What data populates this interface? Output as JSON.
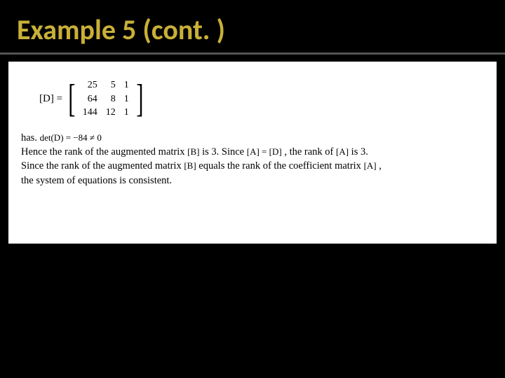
{
  "title": "Example 5 (cont. )",
  "matrix": {
    "lhs": "[D] =",
    "rows": [
      [
        "25",
        "5",
        "1"
      ],
      [
        "64",
        "8",
        "1"
      ],
      [
        "144",
        "12",
        "1"
      ]
    ]
  },
  "text": {
    "has": "has.",
    "det": "det(D) = −84 ≠ 0",
    "line2a": "Hence the rank of the augmented matrix ",
    "B1": "[B]",
    "line2b": " is 3. Since ",
    "AeqD": "[A] = [D]",
    "line2c": ", the rank of ",
    "A1": "[A]",
    "line2d": " is 3.",
    "line3a": "Since the rank of the augmented matrix ",
    "B2": "[B]",
    "line3b": " equals the rank of the coefficient matrix ",
    "A2": "[A]",
    "line3c": " ,",
    "line4": "the system of equations is consistent."
  }
}
